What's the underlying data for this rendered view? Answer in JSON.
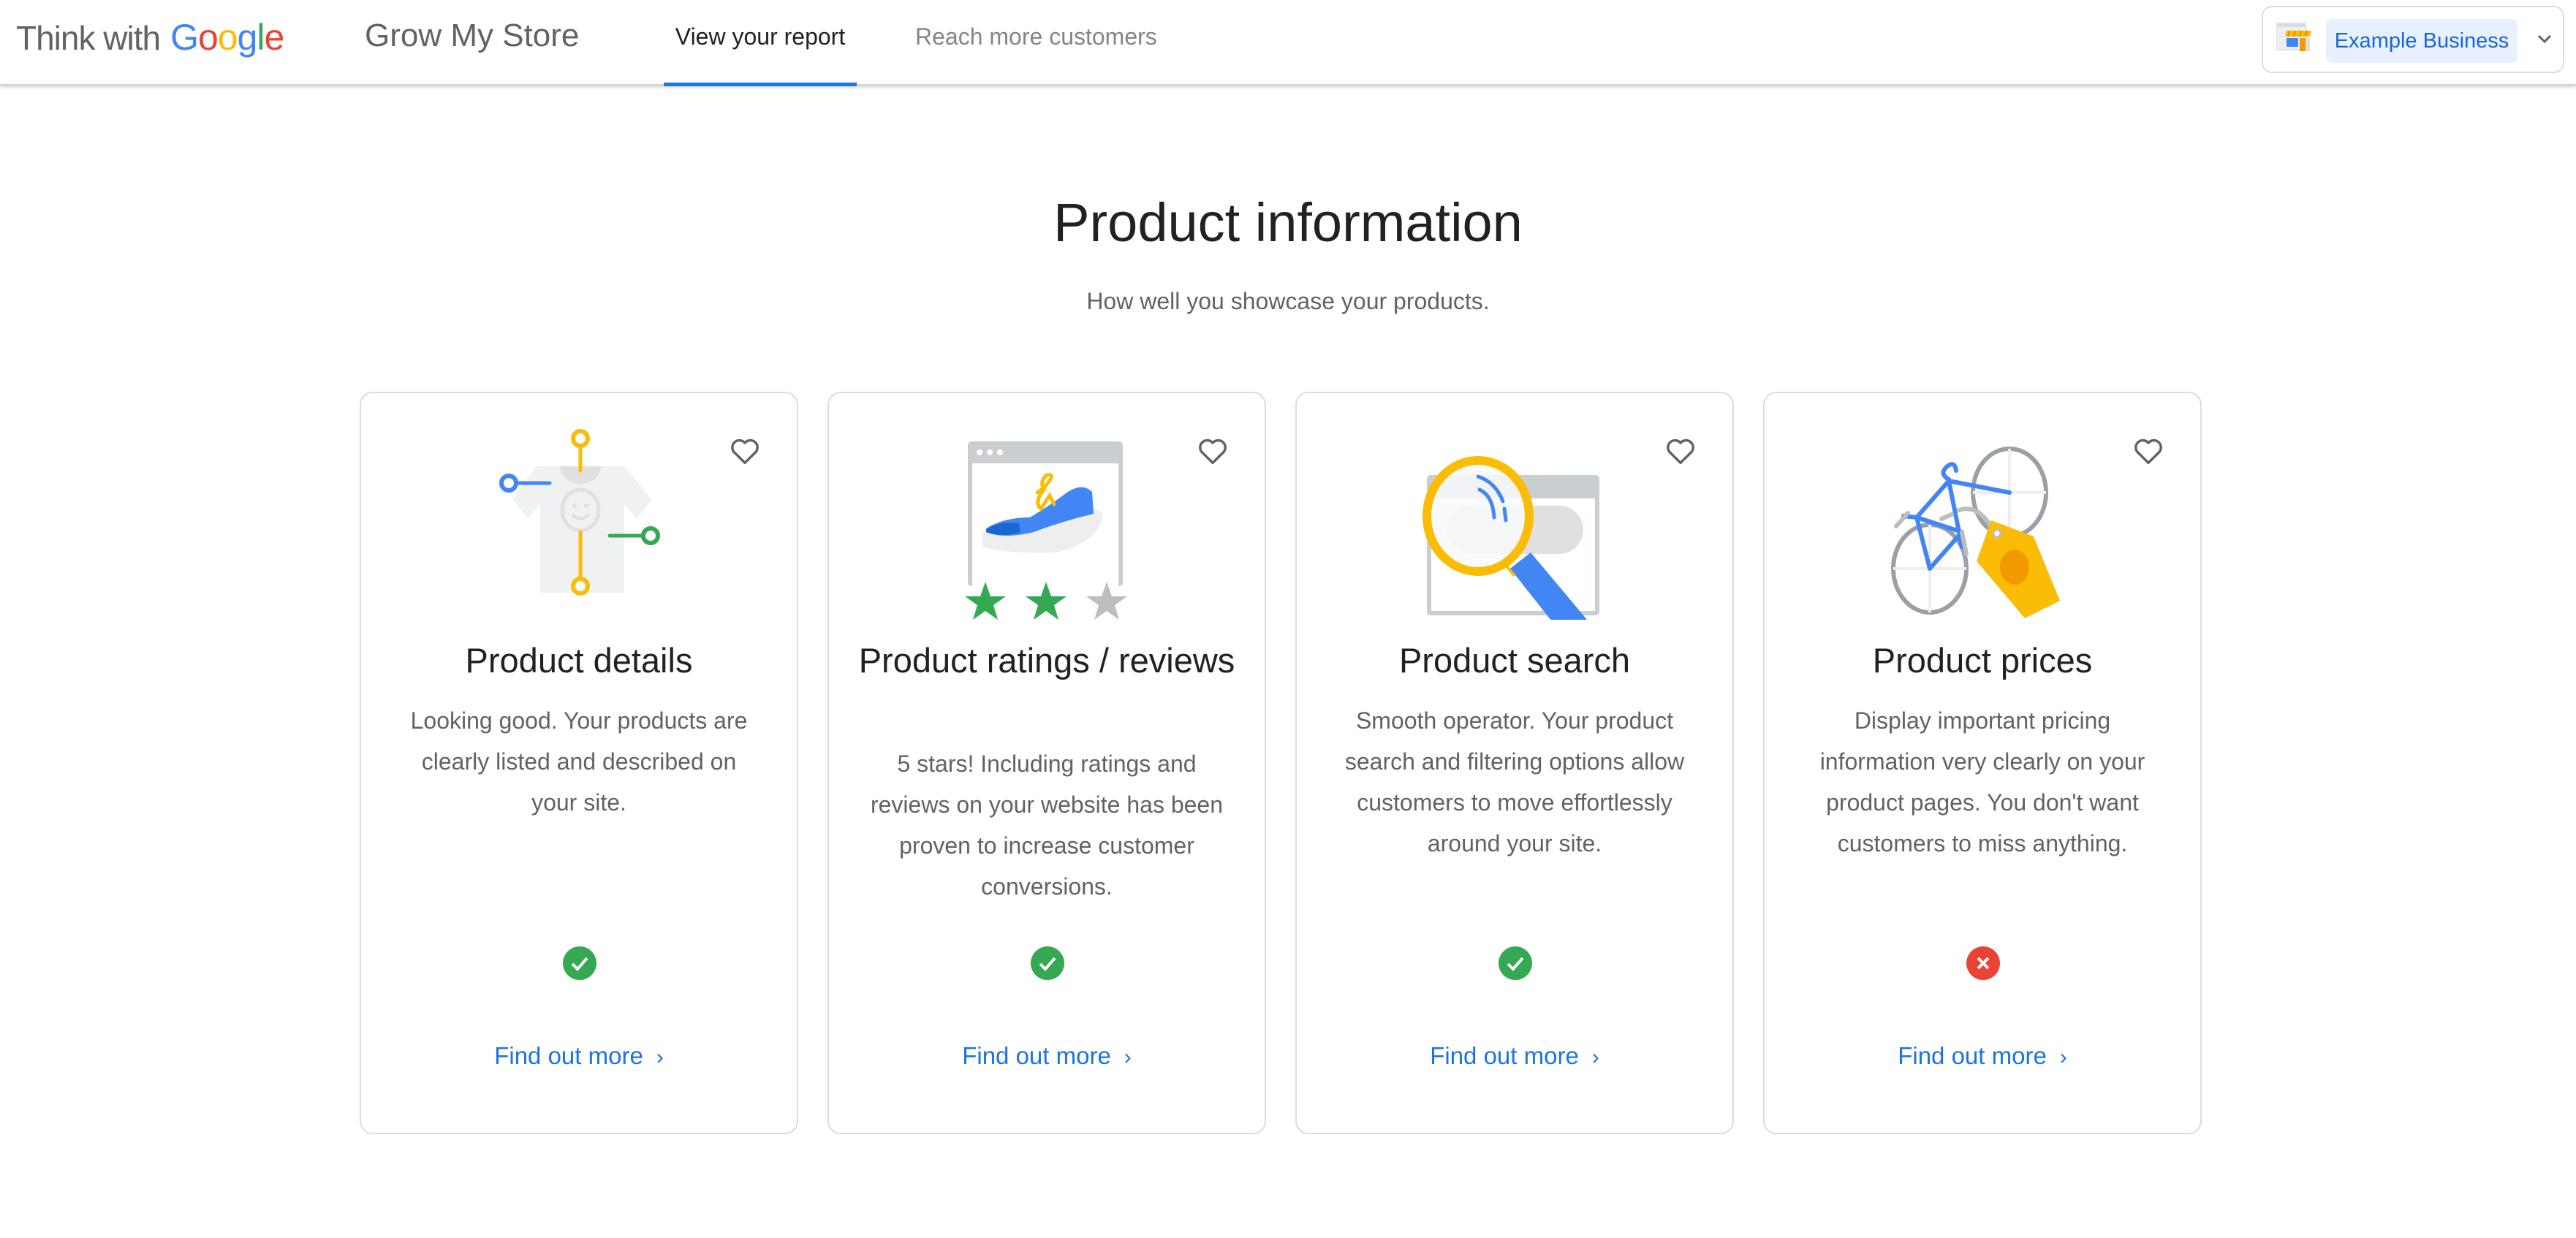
{
  "header": {
    "logo_prefix": "Think with",
    "logo_google": [
      "G",
      "o",
      "o",
      "g",
      "l",
      "e"
    ],
    "app_name": "Grow My Store",
    "tabs": [
      {
        "label": "View your report",
        "active": true
      },
      {
        "label": "Reach more customers",
        "active": false
      }
    ],
    "business_selector": {
      "icon": "storefront-icon",
      "selected": "Example Business",
      "chevron_icon": "chevron-down-icon"
    }
  },
  "section": {
    "title": "Product information",
    "subtitle": "How well you showcase your products."
  },
  "cards": [
    {
      "title": "Product details",
      "description": "Looking good. Your products are clearly listed and described on your site.",
      "illustration": "tshirt-tags-illustration",
      "status": "pass",
      "status_icon": "check-circle-icon",
      "link_label": "Find out more",
      "favorite_icon": "heart-outline-icon"
    },
    {
      "title": "Product ratings / reviews",
      "description": "5 stars! Including ratings and reviews on your website has been proven to increase customer conversions.",
      "illustration": "shoe-rating-illustration",
      "status": "pass",
      "status_icon": "check-circle-icon",
      "link_label": "Find out more",
      "favorite_icon": "heart-outline-icon"
    },
    {
      "title": "Product search",
      "description": "Smooth operator. Your product search and filtering options allow customers to move effortlessly around your site.",
      "illustration": "magnifier-browser-illustration",
      "status": "pass",
      "status_icon": "check-circle-icon",
      "link_label": "Find out more",
      "favorite_icon": "heart-outline-icon"
    },
    {
      "title": "Product prices",
      "description": "Display important pricing information very clearly on your product pages. You don't want customers to miss anything.",
      "illustration": "bicycle-price-tag-illustration",
      "status": "fail",
      "status_icon": "error-circle-icon",
      "link_label": "Find out more",
      "favorite_icon": "heart-outline-icon"
    }
  ],
  "colors": {
    "accent_blue": "#1a73e8",
    "pass_green": "#34a853",
    "fail_red": "#ea4335",
    "chip_bg": "#e8f0fe"
  }
}
